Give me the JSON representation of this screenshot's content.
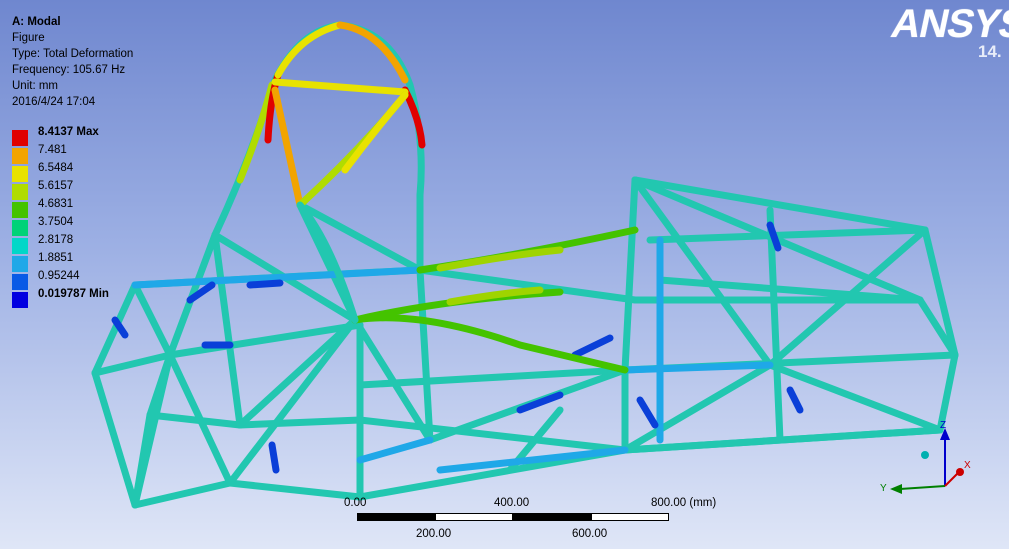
{
  "info": {
    "title": "A: Modal",
    "line1": "Figure",
    "line2": "Type: Total Deformation",
    "line3": "Frequency: 105.67 Hz",
    "line4": "Unit: mm",
    "line5": "2016/4/24 17:04"
  },
  "legend": [
    {
      "label": "8.4137 Max",
      "color": "#e00000",
      "bold": true
    },
    {
      "label": "7.481",
      "color": "#f2a400",
      "bold": false
    },
    {
      "label": "6.5484",
      "color": "#e8e200",
      "bold": false
    },
    {
      "label": "5.6157",
      "color": "#b0dc00",
      "bold": false
    },
    {
      "label": "4.6831",
      "color": "#44c300",
      "bold": false
    },
    {
      "label": "3.7504",
      "color": "#00d278",
      "bold": false
    },
    {
      "label": "2.8178",
      "color": "#00d7c8",
      "bold": false
    },
    {
      "label": "1.8851",
      "color": "#1fa8e8",
      "bold": false
    },
    {
      "label": "0.95244",
      "color": "#0a5ae6",
      "bold": false
    },
    {
      "label": "0.019787 Min",
      "color": "#0000e0",
      "bold": true
    }
  ],
  "logo": {
    "text": "ANSYS",
    "version": "14."
  },
  "scale": {
    "top_labels": [
      "0.00",
      "400.00",
      "800.00 (mm)"
    ],
    "bottom_labels": [
      "200.00",
      "600.00"
    ]
  },
  "axes": {
    "x": "X",
    "y": "Y",
    "z": "Z"
  }
}
